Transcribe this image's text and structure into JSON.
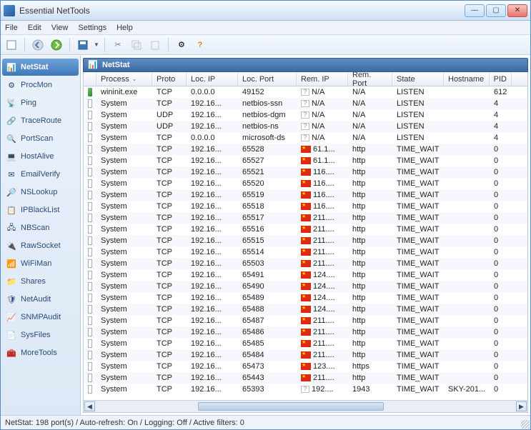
{
  "window": {
    "title": "Essential NetTools"
  },
  "menu": {
    "file": "File",
    "edit": "Edit",
    "view": "View",
    "settings": "Settings",
    "help": "Help"
  },
  "sidebar": {
    "items": [
      {
        "label": "NetStat",
        "icon": "📊"
      },
      {
        "label": "ProcMon",
        "icon": "⚙"
      },
      {
        "label": "Ping",
        "icon": "📡"
      },
      {
        "label": "TraceRoute",
        "icon": "🔗"
      },
      {
        "label": "PortScan",
        "icon": "🔍"
      },
      {
        "label": "HostAlive",
        "icon": "💻"
      },
      {
        "label": "EmailVerify",
        "icon": "✉"
      },
      {
        "label": "NSLookup",
        "icon": "🔎"
      },
      {
        "label": "IPBlackList",
        "icon": "📋"
      },
      {
        "label": "NBScan",
        "icon": "🖧"
      },
      {
        "label": "RawSocket",
        "icon": "🔌"
      },
      {
        "label": "WiFiMan",
        "icon": "📶"
      },
      {
        "label": "Shares",
        "icon": "📁"
      },
      {
        "label": "NetAudit",
        "icon": "🛡"
      },
      {
        "label": "SNMPAudit",
        "icon": "📈"
      },
      {
        "label": "SysFiles",
        "icon": "📄"
      },
      {
        "label": "MoreTools",
        "icon": "🧰"
      }
    ]
  },
  "panel": {
    "title": "NetStat"
  },
  "columns": [
    "Process",
    "Proto",
    "Loc. IP",
    "Loc. Port",
    "Rem. IP",
    "Rem. Port",
    "State",
    "Hostname",
    "PID"
  ],
  "rows": [
    {
      "proc": "wininit.exe",
      "proto": "TCP",
      "lip": "0.0.0.0",
      "lport": "49152",
      "flag": "?",
      "rip": "N/A",
      "rport": "N/A",
      "state": "LISTEN",
      "host": "",
      "pid": "612",
      "exe": true
    },
    {
      "proc": "System",
      "proto": "TCP",
      "lip": "192.16...",
      "lport": "netbios-ssn",
      "flag": "?",
      "rip": "N/A",
      "rport": "N/A",
      "state": "LISTEN",
      "host": "",
      "pid": "4"
    },
    {
      "proc": "System",
      "proto": "UDP",
      "lip": "192.16...",
      "lport": "netbios-dgm",
      "flag": "?",
      "rip": "N/A",
      "rport": "N/A",
      "state": "LISTEN",
      "host": "",
      "pid": "4"
    },
    {
      "proc": "System",
      "proto": "UDP",
      "lip": "192.16...",
      "lport": "netbios-ns",
      "flag": "?",
      "rip": "N/A",
      "rport": "N/A",
      "state": "LISTEN",
      "host": "",
      "pid": "4"
    },
    {
      "proc": "System",
      "proto": "TCP",
      "lip": "0.0.0.0",
      "lport": "microsoft-ds",
      "flag": "?",
      "rip": "N/A",
      "rport": "N/A",
      "state": "LISTEN",
      "host": "",
      "pid": "4"
    },
    {
      "proc": "System",
      "proto": "TCP",
      "lip": "192.16...",
      "lport": "65528",
      "flag": "cn",
      "rip": "61.1...",
      "rport": "http",
      "state": "TIME_WAIT",
      "host": "",
      "pid": "0"
    },
    {
      "proc": "System",
      "proto": "TCP",
      "lip": "192.16...",
      "lport": "65527",
      "flag": "cn",
      "rip": "61.1...",
      "rport": "http",
      "state": "TIME_WAIT",
      "host": "",
      "pid": "0"
    },
    {
      "proc": "System",
      "proto": "TCP",
      "lip": "192.16...",
      "lport": "65521",
      "flag": "cn",
      "rip": "116....",
      "rport": "http",
      "state": "TIME_WAIT",
      "host": "",
      "pid": "0"
    },
    {
      "proc": "System",
      "proto": "TCP",
      "lip": "192.16...",
      "lport": "65520",
      "flag": "cn",
      "rip": "116....",
      "rport": "http",
      "state": "TIME_WAIT",
      "host": "",
      "pid": "0"
    },
    {
      "proc": "System",
      "proto": "TCP",
      "lip": "192.16...",
      "lport": "65519",
      "flag": "cn",
      "rip": "116....",
      "rport": "http",
      "state": "TIME_WAIT",
      "host": "",
      "pid": "0"
    },
    {
      "proc": "System",
      "proto": "TCP",
      "lip": "192.16...",
      "lport": "65518",
      "flag": "cn",
      "rip": "116....",
      "rport": "http",
      "state": "TIME_WAIT",
      "host": "",
      "pid": "0"
    },
    {
      "proc": "System",
      "proto": "TCP",
      "lip": "192.16...",
      "lport": "65517",
      "flag": "cn",
      "rip": "211....",
      "rport": "http",
      "state": "TIME_WAIT",
      "host": "",
      "pid": "0"
    },
    {
      "proc": "System",
      "proto": "TCP",
      "lip": "192.16...",
      "lport": "65516",
      "flag": "cn",
      "rip": "211....",
      "rport": "http",
      "state": "TIME_WAIT",
      "host": "",
      "pid": "0"
    },
    {
      "proc": "System",
      "proto": "TCP",
      "lip": "192.16...",
      "lport": "65515",
      "flag": "cn",
      "rip": "211....",
      "rport": "http",
      "state": "TIME_WAIT",
      "host": "",
      "pid": "0"
    },
    {
      "proc": "System",
      "proto": "TCP",
      "lip": "192.16...",
      "lport": "65514",
      "flag": "cn",
      "rip": "211....",
      "rport": "http",
      "state": "TIME_WAIT",
      "host": "",
      "pid": "0"
    },
    {
      "proc": "System",
      "proto": "TCP",
      "lip": "192.16...",
      "lport": "65503",
      "flag": "cn",
      "rip": "211....",
      "rport": "http",
      "state": "TIME_WAIT",
      "host": "",
      "pid": "0"
    },
    {
      "proc": "System",
      "proto": "TCP",
      "lip": "192.16...",
      "lport": "65491",
      "flag": "cn",
      "rip": "124....",
      "rport": "http",
      "state": "TIME_WAIT",
      "host": "",
      "pid": "0"
    },
    {
      "proc": "System",
      "proto": "TCP",
      "lip": "192.16...",
      "lport": "65490",
      "flag": "cn",
      "rip": "124....",
      "rport": "http",
      "state": "TIME_WAIT",
      "host": "",
      "pid": "0"
    },
    {
      "proc": "System",
      "proto": "TCP",
      "lip": "192.16...",
      "lport": "65489",
      "flag": "cn",
      "rip": "124....",
      "rport": "http",
      "state": "TIME_WAIT",
      "host": "",
      "pid": "0"
    },
    {
      "proc": "System",
      "proto": "TCP",
      "lip": "192.16...",
      "lport": "65488",
      "flag": "cn",
      "rip": "124....",
      "rport": "http",
      "state": "TIME_WAIT",
      "host": "",
      "pid": "0"
    },
    {
      "proc": "System",
      "proto": "TCP",
      "lip": "192.16...",
      "lport": "65487",
      "flag": "cn",
      "rip": "211....",
      "rport": "http",
      "state": "TIME_WAIT",
      "host": "",
      "pid": "0"
    },
    {
      "proc": "System",
      "proto": "TCP",
      "lip": "192.16...",
      "lport": "65486",
      "flag": "cn",
      "rip": "211....",
      "rport": "http",
      "state": "TIME_WAIT",
      "host": "",
      "pid": "0"
    },
    {
      "proc": "System",
      "proto": "TCP",
      "lip": "192.16...",
      "lport": "65485",
      "flag": "cn",
      "rip": "211....",
      "rport": "http",
      "state": "TIME_WAIT",
      "host": "",
      "pid": "0"
    },
    {
      "proc": "System",
      "proto": "TCP",
      "lip": "192.16...",
      "lport": "65484",
      "flag": "cn",
      "rip": "211....",
      "rport": "http",
      "state": "TIME_WAIT",
      "host": "",
      "pid": "0"
    },
    {
      "proc": "System",
      "proto": "TCP",
      "lip": "192.16...",
      "lport": "65473",
      "flag": "cn",
      "rip": "123....",
      "rport": "https",
      "state": "TIME_WAIT",
      "host": "",
      "pid": "0"
    },
    {
      "proc": "System",
      "proto": "TCP",
      "lip": "192.16...",
      "lport": "65443",
      "flag": "cn",
      "rip": "211....",
      "rport": "http",
      "state": "TIME_WAIT",
      "host": "",
      "pid": "0"
    },
    {
      "proc": "System",
      "proto": "TCP",
      "lip": "192.16...",
      "lport": "65393",
      "flag": "?",
      "rip": "192....",
      "rport": "1943",
      "state": "TIME_WAIT",
      "host": "SKY-201...",
      "pid": "0"
    }
  ],
  "status": {
    "text": "NetStat: 198 port(s) / Auto-refresh: On / Logging: Off / Active filters: 0"
  }
}
